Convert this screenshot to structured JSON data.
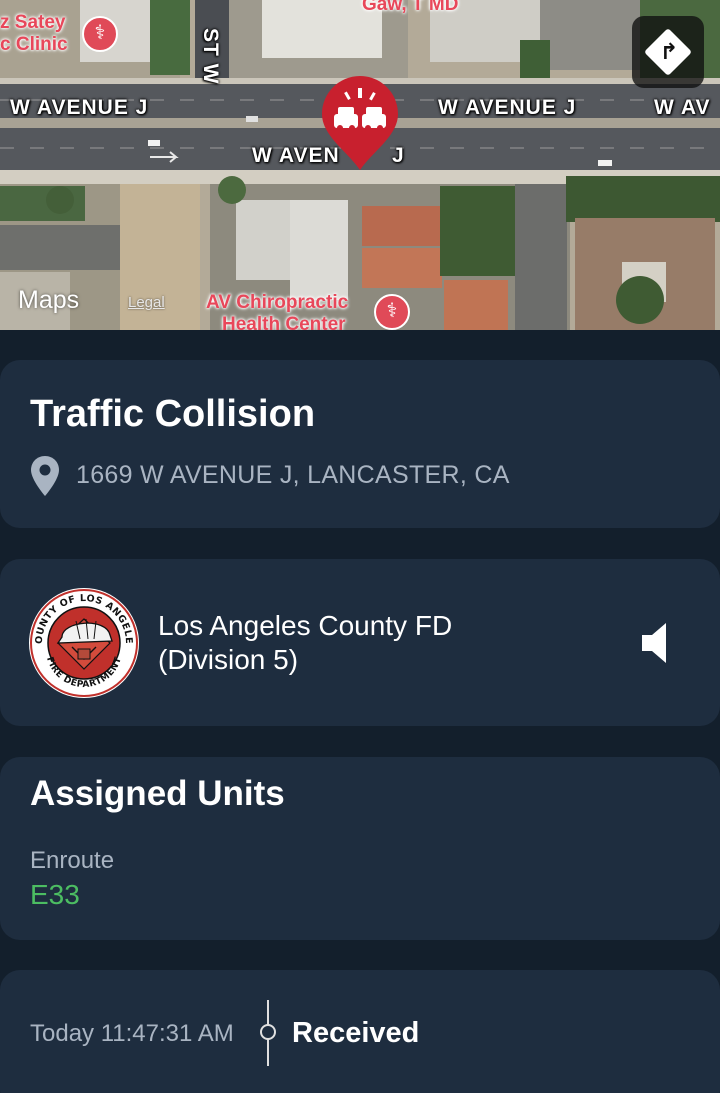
{
  "map": {
    "streets": {
      "avenue_j_left": "W AVENUE J",
      "avenue_j_mid": "W AVENUE J",
      "avenue_j_right": "W AV",
      "avenue_j_lower": "W AVEN",
      "avenue_j_lower_end": "J",
      "st_w": "ST W"
    },
    "pois": {
      "clinic_line1": "z Satey",
      "clinic_line2": "c Clinic",
      "doctor": "Gaw, T MD",
      "chiro_line1": "AV Chiropractic",
      "chiro_line2": "Health Center"
    },
    "brand": "Maps",
    "legal": "Legal",
    "directions_icon": "turn-right-icon",
    "pin_icon": "collision-icon",
    "pin_color": "#c8202e"
  },
  "incident": {
    "title": "Traffic Collision",
    "address": "1669 W AVENUE J, LANCASTER, CA"
  },
  "agency": {
    "name_line1": "Los Angeles County FD",
    "name_line2": "(Division 5)",
    "logo_top": "COUNTY OF LOS ANGELES",
    "logo_bottom": "FIRE DEPARTMENT"
  },
  "units": {
    "title": "Assigned Units",
    "status": "Enroute",
    "unit": "E33",
    "unit_color": "#4cbd62"
  },
  "timeline": {
    "time": "Today 11:47:31 AM",
    "event": "Received"
  }
}
